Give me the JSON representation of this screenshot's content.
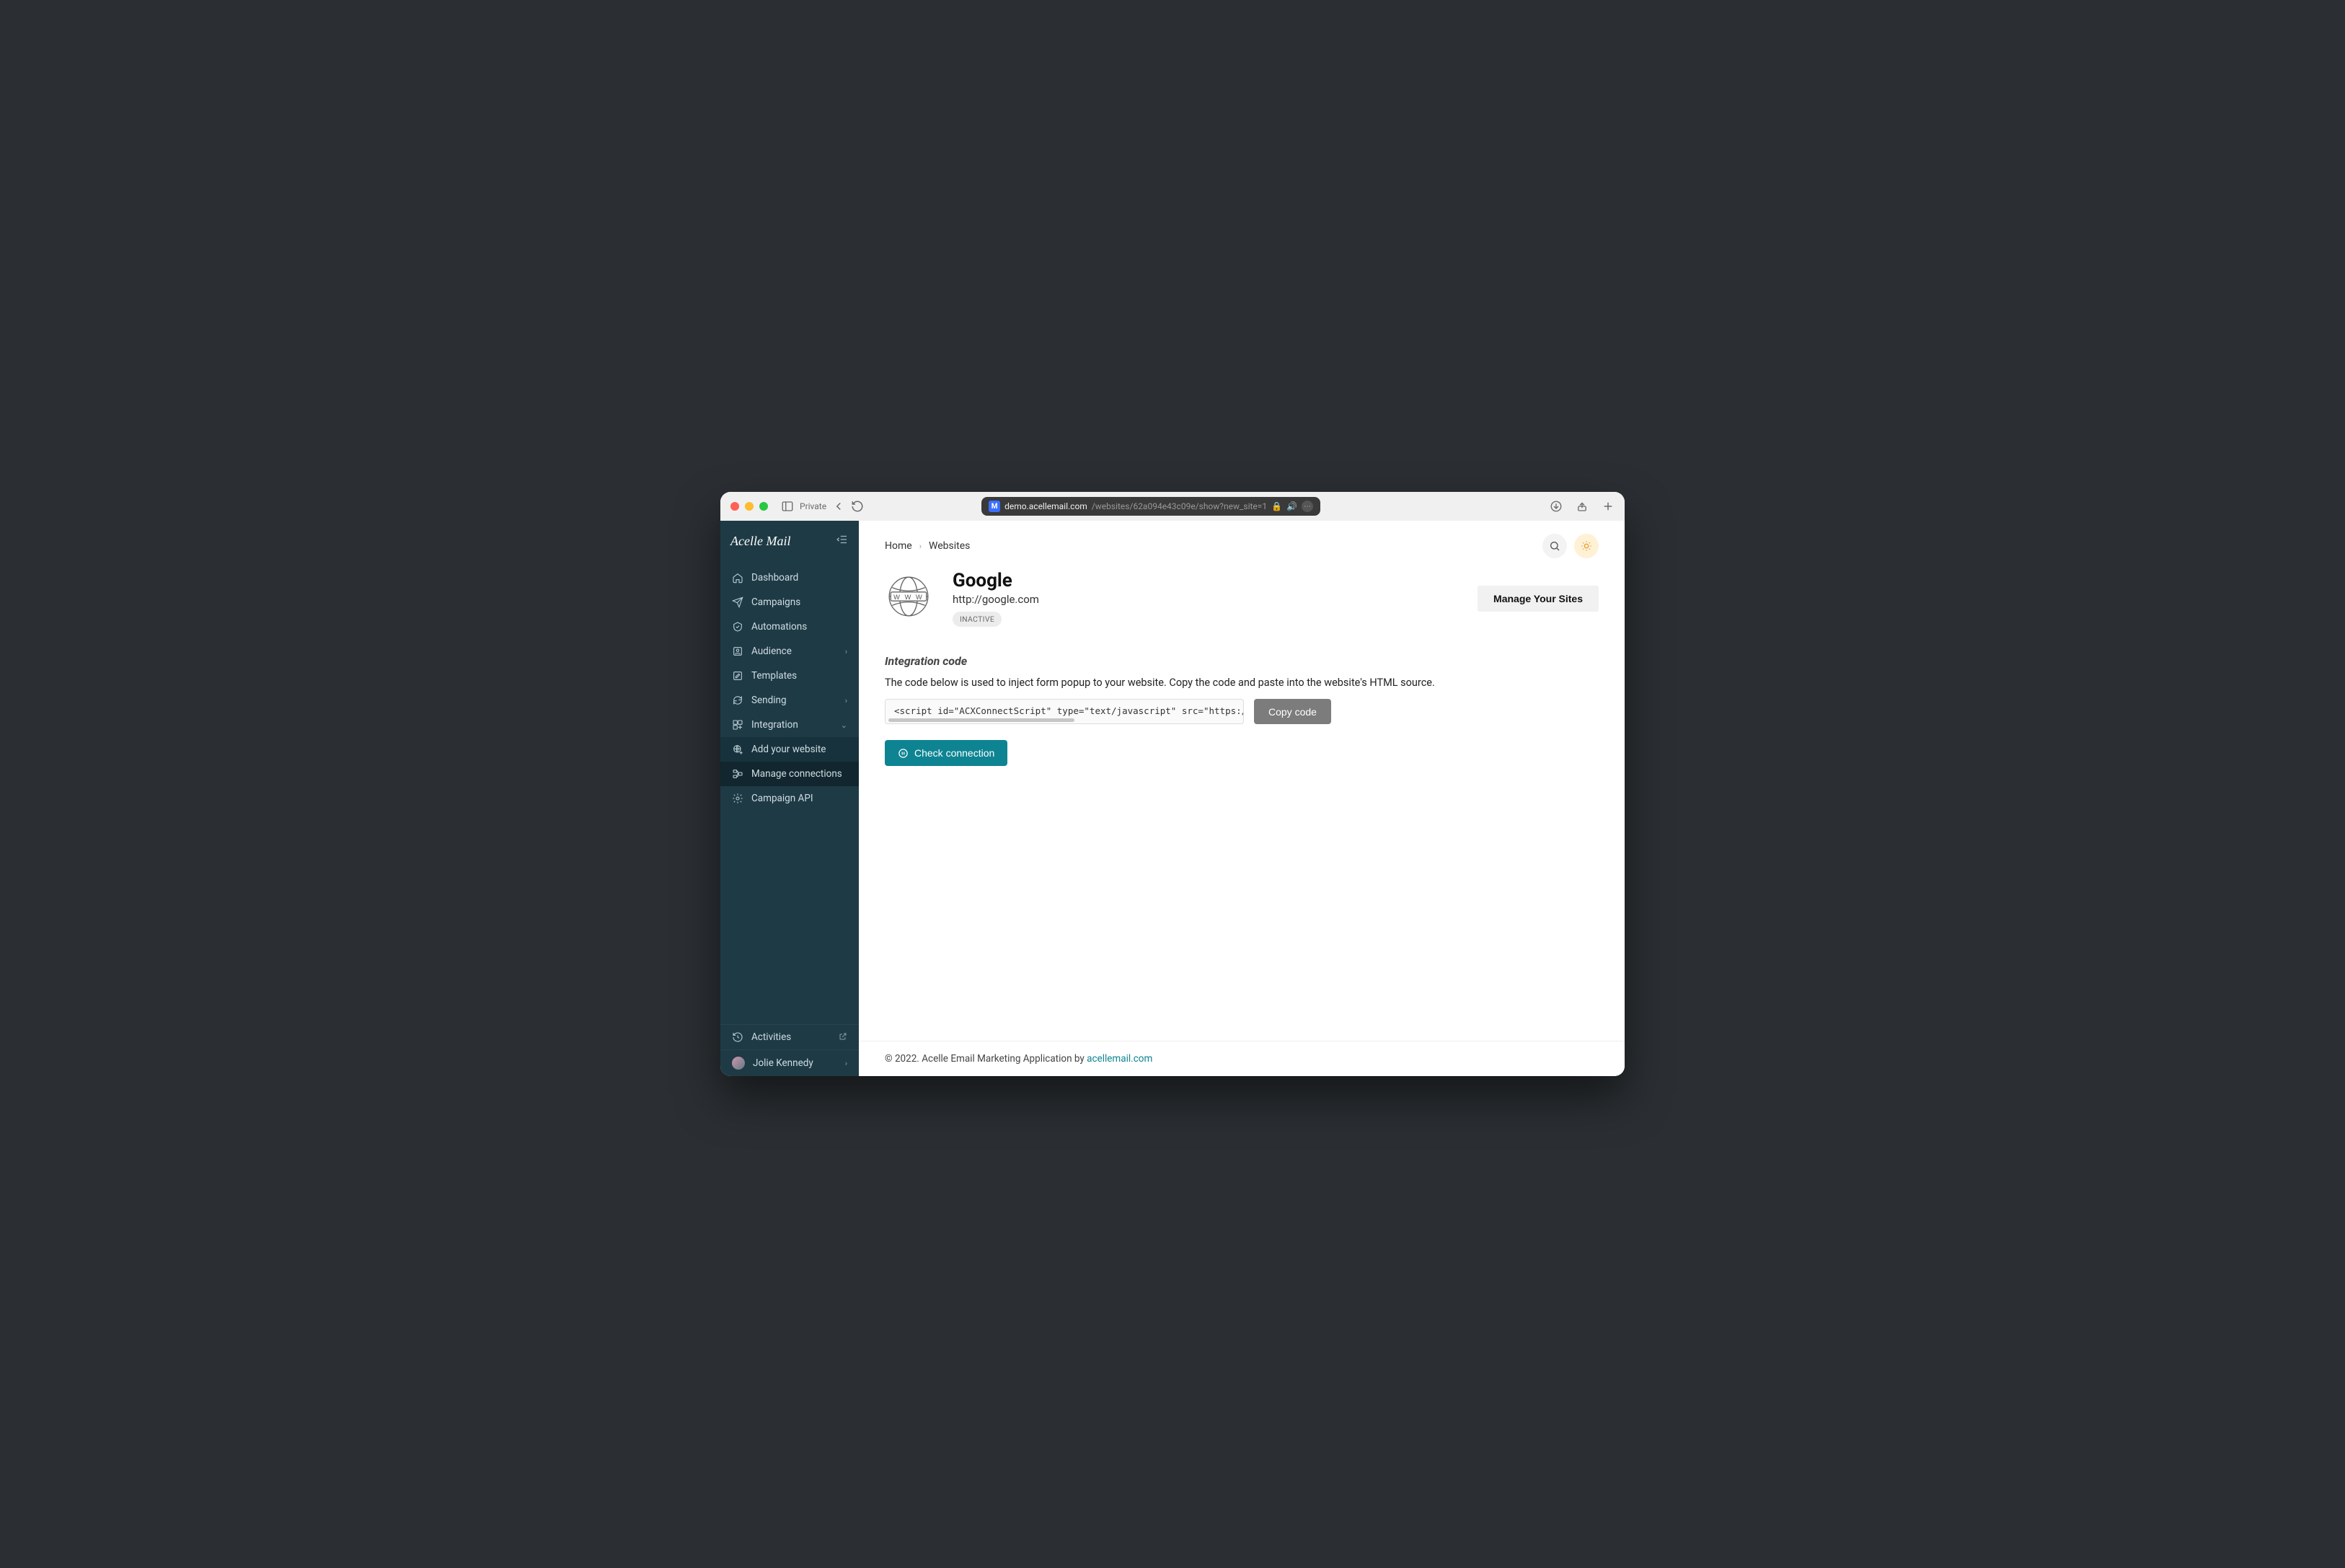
{
  "browser": {
    "private_label": "Private",
    "url_host": "demo.acellemail.com",
    "url_path": "/websites/62a094e43c09e/show?new_site=1"
  },
  "brand": {
    "name": "Acelle",
    "suffix": "Mail"
  },
  "nav": {
    "dashboard": "Dashboard",
    "campaigns": "Campaigns",
    "automations": "Automations",
    "audience": "Audience",
    "templates": "Templates",
    "sending": "Sending",
    "integration": "Integration",
    "add_website": "Add your website",
    "manage_connections": "Manage connections",
    "campaign_api": "Campaign API",
    "activities": "Activities",
    "user_name": "Jolie Kennedy"
  },
  "breadcrumb": {
    "home": "Home",
    "websites": "Websites"
  },
  "site": {
    "title": "Google",
    "url": "http://google.com",
    "status": "INACTIVE",
    "manage_label": "Manage Your Sites"
  },
  "integration": {
    "heading": "Integration code",
    "description": "The code below is used to inject form popup to your website. Copy the code and paste into the website's HTML source.",
    "code_snippet": "<script id=\"ACXConnectScript\" type=\"text/javascript\" src=\"https://demo",
    "copy_label": "Copy code",
    "check_label": "Check connection"
  },
  "footer": {
    "text": "© 2022. Acelle Email Marketing Application by ",
    "link_label": "acellemail.com"
  }
}
